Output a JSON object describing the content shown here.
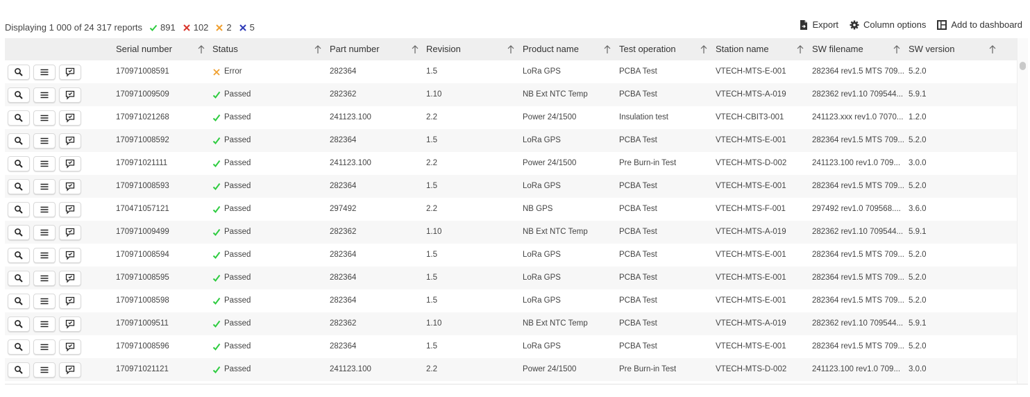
{
  "summary": {
    "text": "Displaying 1 000 of 24 317 reports",
    "passed_count": "891",
    "failed_count": "102",
    "error_count": "2",
    "terminated_count": "5"
  },
  "colors": {
    "passed": "#2ecc40",
    "failed": "#d9342b",
    "error": "#f0a030",
    "terminated": "#2e3bb8"
  },
  "actions": {
    "export": "Export",
    "column_options": "Column options",
    "add_to_dashboard": "Add to dashboard"
  },
  "columns": [
    "Serial number",
    "Status",
    "Part number",
    "Revision",
    "Product name",
    "Test operation",
    "Station name",
    "SW filename",
    "SW version"
  ],
  "rows": [
    {
      "serial": "170971008591",
      "status": "Error",
      "status_icon": "error-x-icon",
      "part": "282364",
      "revision": "1.5",
      "product": "LoRa GPS",
      "operation": "PCBA Test",
      "station": "VTECH-MTS-E-001",
      "sw_file": "282364 rev1.5 MTS 709...",
      "sw_version": "5.2.0"
    },
    {
      "serial": "170971009509",
      "status": "Passed",
      "status_icon": "passed-check-icon",
      "part": "282362",
      "revision": "1.10",
      "product": "NB Ext NTC Temp",
      "operation": "PCBA Test",
      "station": "VTECH-MTS-A-019",
      "sw_file": "282362 rev1.10 709544...",
      "sw_version": "5.9.1"
    },
    {
      "serial": "170971021268",
      "status": "Passed",
      "status_icon": "passed-check-icon",
      "part": "241123.100",
      "revision": "2.2",
      "product": "Power 24/1500",
      "operation": "Insulation test",
      "station": "VTECH-CBIT3-001",
      "sw_file": "241123.xxx rev1.0 7070...",
      "sw_version": "1.2.0"
    },
    {
      "serial": "170971008592",
      "status": "Passed",
      "status_icon": "passed-check-icon",
      "part": "282364",
      "revision": "1.5",
      "product": "LoRa GPS",
      "operation": "PCBA Test",
      "station": "VTECH-MTS-E-001",
      "sw_file": "282364 rev1.5 MTS 709...",
      "sw_version": "5.2.0"
    },
    {
      "serial": "170971021111",
      "status": "Passed",
      "status_icon": "passed-check-icon",
      "part": "241123.100",
      "revision": "2.2",
      "product": "Power 24/1500",
      "operation": "Pre Burn-in Test",
      "station": "VTECH-MTS-D-002",
      "sw_file": "241123.100 rev1.0 709...",
      "sw_version": "3.0.0"
    },
    {
      "serial": "170971008593",
      "status": "Passed",
      "status_icon": "passed-check-icon",
      "part": "282364",
      "revision": "1.5",
      "product": "LoRa GPS",
      "operation": "PCBA Test",
      "station": "VTECH-MTS-E-001",
      "sw_file": "282364 rev1.5 MTS 709...",
      "sw_version": "5.2.0"
    },
    {
      "serial": "170471057121",
      "status": "Passed",
      "status_icon": "passed-check-icon",
      "part": "297492",
      "revision": "2.2",
      "product": "NB GPS",
      "operation": "PCBA Test",
      "station": "VTECH-MTS-F-001",
      "sw_file": "297492 rev1.0 709568....",
      "sw_version": "3.6.0"
    },
    {
      "serial": "170971009499",
      "status": "Passed",
      "status_icon": "passed-check-icon",
      "part": "282362",
      "revision": "1.10",
      "product": "NB Ext NTC Temp",
      "operation": "PCBA Test",
      "station": "VTECH-MTS-A-019",
      "sw_file": "282362 rev1.10 709544...",
      "sw_version": "5.9.1"
    },
    {
      "serial": "170971008594",
      "status": "Passed",
      "status_icon": "passed-check-icon",
      "part": "282364",
      "revision": "1.5",
      "product": "LoRa GPS",
      "operation": "PCBA Test",
      "station": "VTECH-MTS-E-001",
      "sw_file": "282364 rev1.5 MTS 709...",
      "sw_version": "5.2.0"
    },
    {
      "serial": "170971008595",
      "status": "Passed",
      "status_icon": "passed-check-icon",
      "part": "282364",
      "revision": "1.5",
      "product": "LoRa GPS",
      "operation": "PCBA Test",
      "station": "VTECH-MTS-E-001",
      "sw_file": "282364 rev1.5 MTS 709...",
      "sw_version": "5.2.0"
    },
    {
      "serial": "170971008598",
      "status": "Passed",
      "status_icon": "passed-check-icon",
      "part": "282364",
      "revision": "1.5",
      "product": "LoRa GPS",
      "operation": "PCBA Test",
      "station": "VTECH-MTS-E-001",
      "sw_file": "282364 rev1.5 MTS 709...",
      "sw_version": "5.2.0"
    },
    {
      "serial": "170971009511",
      "status": "Passed",
      "status_icon": "passed-check-icon",
      "part": "282362",
      "revision": "1.10",
      "product": "NB Ext NTC Temp",
      "operation": "PCBA Test",
      "station": "VTECH-MTS-A-019",
      "sw_file": "282362 rev1.10 709544...",
      "sw_version": "5.9.1"
    },
    {
      "serial": "170971008596",
      "status": "Passed",
      "status_icon": "passed-check-icon",
      "part": "282364",
      "revision": "1.5",
      "product": "LoRa GPS",
      "operation": "PCBA Test",
      "station": "VTECH-MTS-E-001",
      "sw_file": "282364 rev1.5 MTS 709...",
      "sw_version": "5.2.0"
    },
    {
      "serial": "170971021121",
      "status": "Passed",
      "status_icon": "passed-check-icon",
      "part": "241123.100",
      "revision": "2.2",
      "product": "Power 24/1500",
      "operation": "Pre Burn-in Test",
      "station": "VTECH-MTS-D-002",
      "sw_file": "241123.100 rev1.0 709...",
      "sw_version": "3.0.0"
    }
  ],
  "row_buttons": [
    "search-icon",
    "menu-icon",
    "comment-icon"
  ]
}
